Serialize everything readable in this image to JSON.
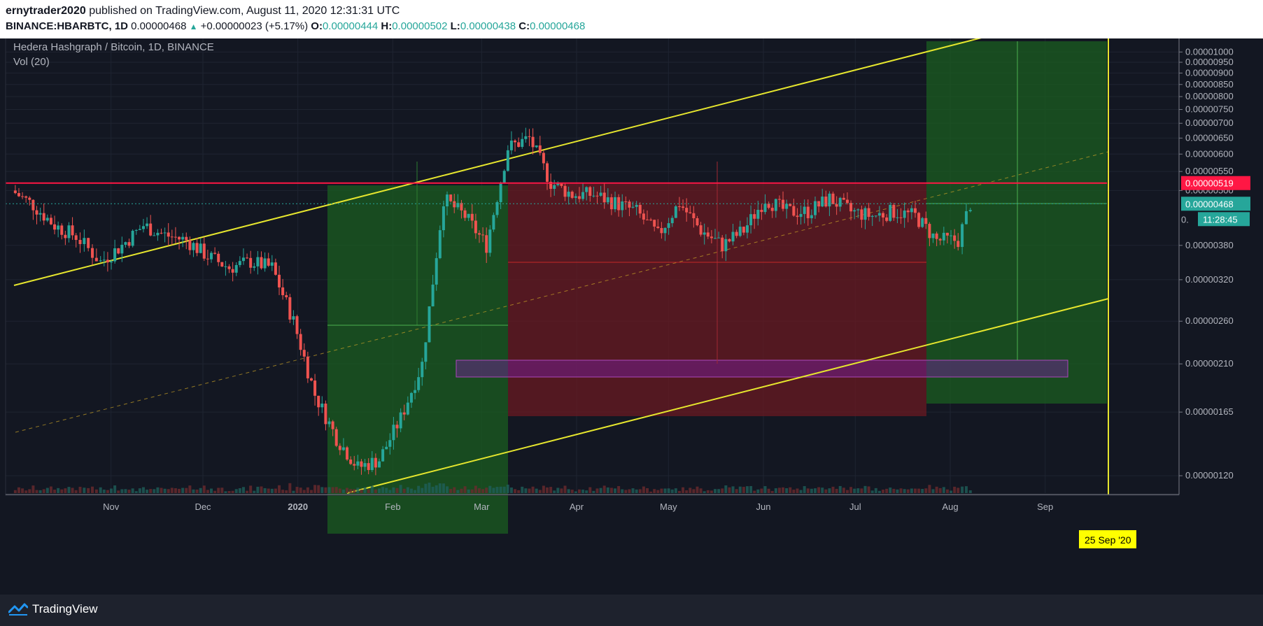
{
  "header": {
    "author": "ernytrader2020",
    "published": "published on TradingView.com, August 11, 2020 12:31:31 UTC",
    "symbol": "BINANCE:HBARBTC, 1D",
    "last": "0.00000468",
    "change": "+0.00000023 (+5.17%)",
    "o_label": "O:",
    "o_value": "0.00000444",
    "h_label": "H:",
    "h_value": "0.00000502",
    "l_label": "L:",
    "l_value": "0.00000438",
    "c_label": "C:",
    "c_value": "0.00000468"
  },
  "chart_data": {
    "type": "candlestick",
    "title": "Hedera Hashgraph / Bitcoin, 1D, BINANCE",
    "indicator": "Vol (20)",
    "x_labels": [
      "Nov",
      "Dec",
      "2020",
      "Feb",
      "Mar",
      "Apr",
      "May",
      "Jun",
      "Jul",
      "Aug",
      "Sep"
    ],
    "y_scale": "log",
    "y_ticks": [
      "0.00001000",
      "0.00000950",
      "0.00000900",
      "0.00000850",
      "0.00000800",
      "0.00000750",
      "0.00000700",
      "0.00000650",
      "0.00000600",
      "0.00000550",
      "0.00000500",
      "0.00000380",
      "0.00000320",
      "0.00000260",
      "0.00000210",
      "0.00000165",
      "0.00000120"
    ],
    "y_range": [
      1.1e-06,
      1.07e-05
    ],
    "price_markers": [
      {
        "label": "0.00000519",
        "value": 5.19e-06,
        "color": "#ff1744"
      },
      {
        "label": "0.00000468",
        "value": 4.68e-06,
        "color": "#26a69a"
      }
    ],
    "countdown": {
      "prefix": "0.",
      "text": "11:28:45"
    },
    "vertical_marker": {
      "label": "25 Sep '20",
      "date": "2020-09-25"
    },
    "colors": {
      "up": "#26a69a",
      "down": "#ef5350",
      "trend": "#e6e62e",
      "resistance": "#ff1744",
      "support_zone": "#9c27b0"
    },
    "closes": [
      {
        "date": "2019-10-03",
        "close": 5e-06
      },
      {
        "date": "2019-10-10",
        "close": 4.65e-06
      },
      {
        "date": "2019-10-17",
        "close": 4.2e-06
      },
      {
        "date": "2019-10-24",
        "close": 3.98e-06
      },
      {
        "date": "2019-11-01",
        "close": 3.5e-06
      },
      {
        "date": "2019-11-08",
        "close": 3.8e-06
      },
      {
        "date": "2019-11-15",
        "close": 4.2e-06
      },
      {
        "date": "2019-11-22",
        "close": 4e-06
      },
      {
        "date": "2019-11-29",
        "close": 3.9e-06
      },
      {
        "date": "2019-12-06",
        "close": 3.6e-06
      },
      {
        "date": "2019-12-13",
        "close": 3.4e-06
      },
      {
        "date": "2019-12-20",
        "close": 3.5e-06
      },
      {
        "date": "2019-12-27",
        "close": 3.4e-06
      },
      {
        "date": "2020-01-03",
        "close": 2.6e-06
      },
      {
        "date": "2020-01-10",
        "close": 1.8e-06
      },
      {
        "date": "2020-01-17",
        "close": 1.45e-06
      },
      {
        "date": "2020-01-24",
        "close": 1.25e-06
      },
      {
        "date": "2020-01-31",
        "close": 1.3e-06
      },
      {
        "date": "2020-02-07",
        "close": 1.6e-06
      },
      {
        "date": "2020-02-14",
        "close": 2.1e-06
      },
      {
        "date": "2020-02-21",
        "close": 4.8e-06
      },
      {
        "date": "2020-02-28",
        "close": 4.4e-06
      },
      {
        "date": "2020-03-06",
        "close": 3.8e-06
      },
      {
        "date": "2020-03-13",
        "close": 6.2e-06
      },
      {
        "date": "2020-03-20",
        "close": 6.5e-06
      },
      {
        "date": "2020-03-27",
        "close": 5.2e-06
      },
      {
        "date": "2020-04-03",
        "close": 4.9e-06
      },
      {
        "date": "2020-04-10",
        "close": 4.9e-06
      },
      {
        "date": "2020-04-17",
        "close": 4.7e-06
      },
      {
        "date": "2020-04-24",
        "close": 4.5e-06
      },
      {
        "date": "2020-05-01",
        "close": 4e-06
      },
      {
        "date": "2020-05-08",
        "close": 4.7e-06
      },
      {
        "date": "2020-05-15",
        "close": 4.1e-06
      },
      {
        "date": "2020-05-22",
        "close": 3.8e-06
      },
      {
        "date": "2020-05-29",
        "close": 4.1e-06
      },
      {
        "date": "2020-06-05",
        "close": 4.8e-06
      },
      {
        "date": "2020-06-12",
        "close": 4.5e-06
      },
      {
        "date": "2020-06-19",
        "close": 4.5e-06
      },
      {
        "date": "2020-06-26",
        "close": 4.8e-06
      },
      {
        "date": "2020-07-03",
        "close": 4.5e-06
      },
      {
        "date": "2020-07-10",
        "close": 4.4e-06
      },
      {
        "date": "2020-07-17",
        "close": 4.5e-06
      },
      {
        "date": "2020-07-24",
        "close": 4.4e-06
      },
      {
        "date": "2020-07-31",
        "close": 3.9e-06
      },
      {
        "date": "2020-08-07",
        "close": 3.9e-06
      },
      {
        "date": "2020-08-11",
        "close": 4.68e-06
      }
    ]
  },
  "footer": {
    "brand": "TradingView"
  }
}
